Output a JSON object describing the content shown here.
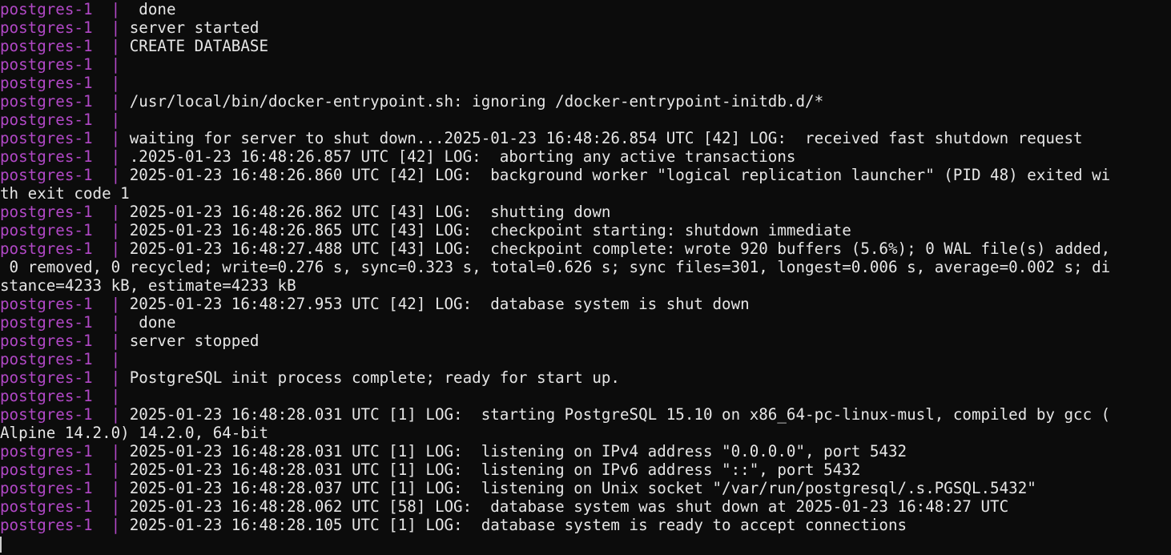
{
  "terminal": {
    "colors": {
      "background": "#0c0c0c",
      "prefix": "#b148c6",
      "text": "#e6e6e6"
    },
    "lines": [
      {
        "prefix": "postgres-1  | ",
        "text": " done"
      },
      {
        "prefix": "postgres-1  | ",
        "text": "server started"
      },
      {
        "prefix": "postgres-1  | ",
        "text": "CREATE DATABASE"
      },
      {
        "prefix": "postgres-1  | ",
        "text": ""
      },
      {
        "prefix": "postgres-1  | ",
        "text": ""
      },
      {
        "prefix": "postgres-1  | ",
        "text": "/usr/local/bin/docker-entrypoint.sh: ignoring /docker-entrypoint-initdb.d/*"
      },
      {
        "prefix": "postgres-1  | ",
        "text": ""
      },
      {
        "prefix": "postgres-1  | ",
        "text": "waiting for server to shut down...2025-01-23 16:48:26.854 UTC [42] LOG:  received fast shutdown request"
      },
      {
        "prefix": "postgres-1  | ",
        "text": ".2025-01-23 16:48:26.857 UTC [42] LOG:  aborting any active transactions"
      },
      {
        "prefix": "postgres-1  | ",
        "text": "2025-01-23 16:48:26.860 UTC [42] LOG:  background worker \"logical replication launcher\" (PID 48) exited wi"
      },
      {
        "prefix": "",
        "text": "th exit code 1"
      },
      {
        "prefix": "postgres-1  | ",
        "text": "2025-01-23 16:48:26.862 UTC [43] LOG:  shutting down"
      },
      {
        "prefix": "postgres-1  | ",
        "text": "2025-01-23 16:48:26.865 UTC [43] LOG:  checkpoint starting: shutdown immediate"
      },
      {
        "prefix": "postgres-1  | ",
        "text": "2025-01-23 16:48:27.488 UTC [43] LOG:  checkpoint complete: wrote 920 buffers (5.6%); 0 WAL file(s) added,"
      },
      {
        "prefix": "",
        "text": " 0 removed, 0 recycled; write=0.276 s, sync=0.323 s, total=0.626 s; sync files=301, longest=0.006 s, average=0.002 s; di"
      },
      {
        "prefix": "",
        "text": "stance=4233 kB, estimate=4233 kB"
      },
      {
        "prefix": "postgres-1  | ",
        "text": "2025-01-23 16:48:27.953 UTC [42] LOG:  database system is shut down"
      },
      {
        "prefix": "postgres-1  | ",
        "text": " done"
      },
      {
        "prefix": "postgres-1  | ",
        "text": "server stopped"
      },
      {
        "prefix": "postgres-1  | ",
        "text": ""
      },
      {
        "prefix": "postgres-1  | ",
        "text": "PostgreSQL init process complete; ready for start up."
      },
      {
        "prefix": "postgres-1  | ",
        "text": ""
      },
      {
        "prefix": "postgres-1  | ",
        "text": "2025-01-23 16:48:28.031 UTC [1] LOG:  starting PostgreSQL 15.10 on x86_64-pc-linux-musl, compiled by gcc ("
      },
      {
        "prefix": "",
        "text": "Alpine 14.2.0) 14.2.0, 64-bit"
      },
      {
        "prefix": "postgres-1  | ",
        "text": "2025-01-23 16:48:28.031 UTC [1] LOG:  listening on IPv4 address \"0.0.0.0\", port 5432"
      },
      {
        "prefix": "postgres-1  | ",
        "text": "2025-01-23 16:48:28.031 UTC [1] LOG:  listening on IPv6 address \"::\", port 5432"
      },
      {
        "prefix": "postgres-1  | ",
        "text": "2025-01-23 16:48:28.037 UTC [1] LOG:  listening on Unix socket \"/var/run/postgresql/.s.PGSQL.5432\""
      },
      {
        "prefix": "postgres-1  | ",
        "text": "2025-01-23 16:48:28.062 UTC [58] LOG:  database system was shut down at 2025-01-23 16:48:27 UTC"
      },
      {
        "prefix": "postgres-1  | ",
        "text": "2025-01-23 16:48:28.105 UTC [1] LOG:  database system is ready to accept connections"
      }
    ]
  }
}
